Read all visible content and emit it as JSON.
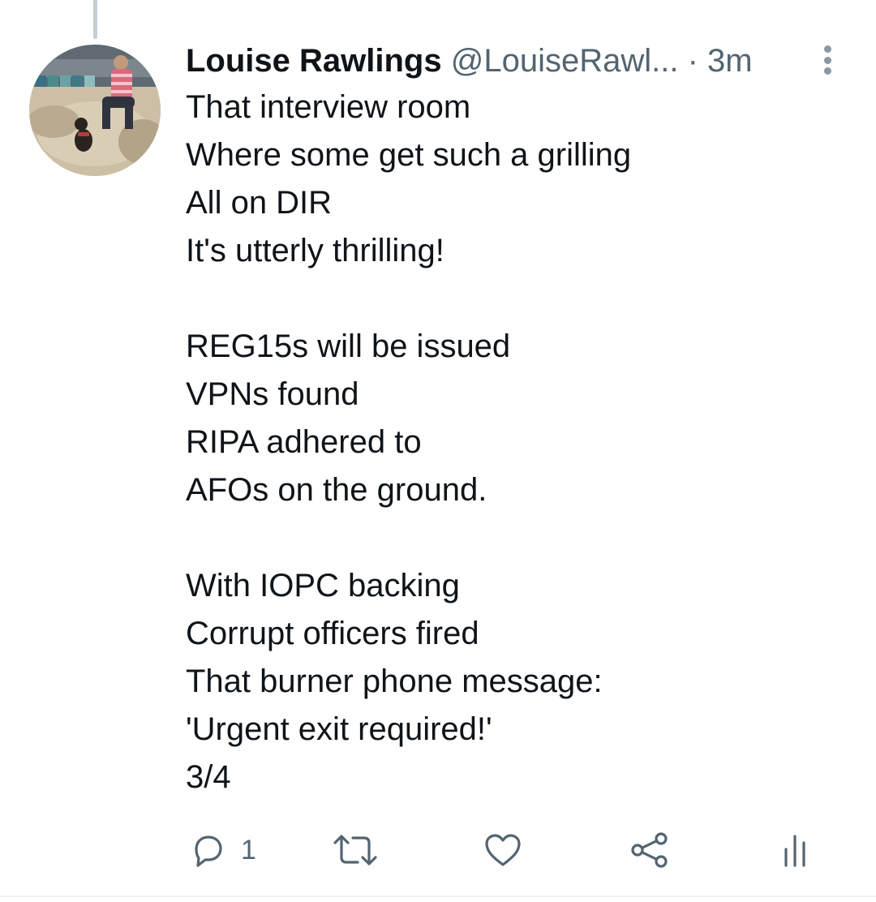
{
  "tweet": {
    "author": {
      "display_name": "Louise Rawlings",
      "handle": "@LouiseRawl...",
      "avatar_icon": "profile-photo"
    },
    "separator": "·",
    "timestamp": "3m",
    "lines": [
      "That interview room",
      "Where some get such a grilling",
      "All on DIR",
      "It's utterly thrilling!",
      "",
      "REG15s will be issued",
      "VPNs found",
      "RIPA adhered to",
      "AFOs on the ground.",
      "",
      "With IOPC backing",
      "Corrupt officers fired",
      "That burner phone message:",
      "'Urgent exit required!'",
      "3/4"
    ],
    "actions": {
      "reply": {
        "icon": "reply-icon",
        "count": "1"
      },
      "retweet": {
        "icon": "retweet-icon"
      },
      "like": {
        "icon": "heart-icon"
      },
      "share": {
        "icon": "share-icon"
      },
      "analytics": {
        "icon": "analytics-icon"
      }
    },
    "colors": {
      "text": "#0f1419",
      "secondary": "#536471",
      "thread_line": "#c4cfd6"
    }
  }
}
